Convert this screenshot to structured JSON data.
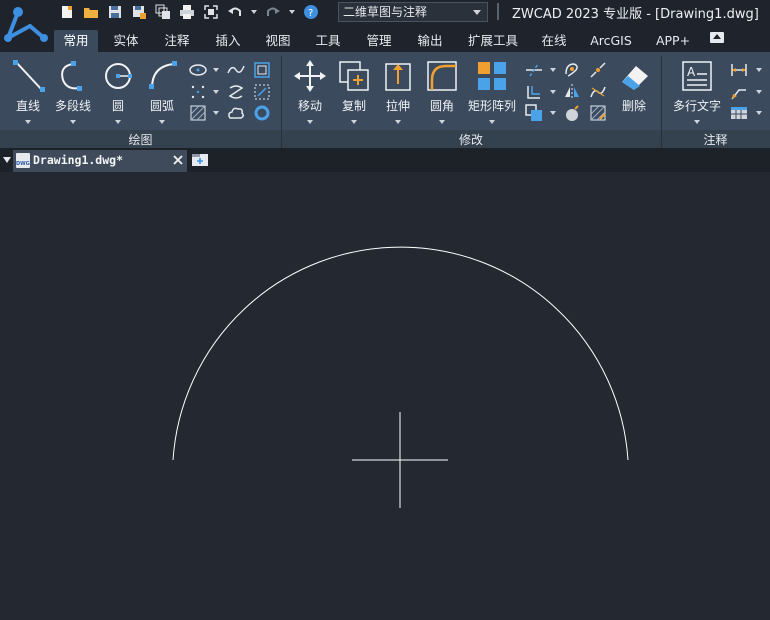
{
  "app": {
    "title": "ZWCAD 2023 专业版 - [Drawing1.dwg]",
    "logo_icon": "zwcad-logo-icon"
  },
  "quick_access": {
    "workspace": "二维草图与注释",
    "buttons": [
      "new-icon",
      "open-folder-icon",
      "save-icon",
      "save-as-icon",
      "layers-icon",
      "print-icon",
      "fullscreen-icon",
      "undo-icon",
      "redo-icon",
      "help-icon"
    ]
  },
  "ribbon_tabs": [
    {
      "label": "常用",
      "active": true
    },
    {
      "label": "实体",
      "active": false
    },
    {
      "label": "注释",
      "active": false
    },
    {
      "label": "插入",
      "active": false
    },
    {
      "label": "视图",
      "active": false
    },
    {
      "label": "工具",
      "active": false
    },
    {
      "label": "管理",
      "active": false
    },
    {
      "label": "输出",
      "active": false
    },
    {
      "label": "扩展工具",
      "active": false
    },
    {
      "label": "在线",
      "active": false
    },
    {
      "label": "ArcGIS",
      "active": false
    },
    {
      "label": "APP+",
      "active": false
    }
  ],
  "panels": {
    "draw": {
      "title": "绘图",
      "line": "直线",
      "polyline": "多段线",
      "circle": "圆",
      "arc": "圆弧"
    },
    "modify": {
      "title": "修改",
      "move": "移动",
      "copy": "复制",
      "stretch": "拉伸",
      "fillet": "圆角",
      "array": "矩形阵列",
      "erase": "删除"
    },
    "annotation": {
      "title": "注释",
      "mtext": "多行文字"
    }
  },
  "document": {
    "tab_name": "Drawing1.dwg*"
  },
  "colors": {
    "background": "#232831",
    "ribbon": "#3b4a5d",
    "accent_blue": "#4aa3e8",
    "accent_orange": "#f0a030",
    "drawing_stroke": "#ffffff"
  }
}
